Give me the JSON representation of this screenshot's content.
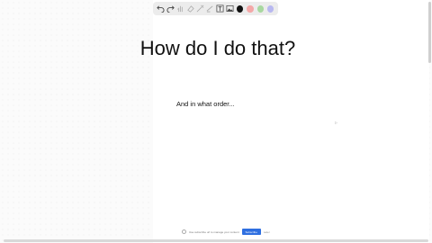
{
  "canvas": {
    "heading": "How do I do that?",
    "subtext": "And in what order..."
  },
  "toolbar": {
    "tools": [
      "undo-icon",
      "redo-icon",
      "hand-icon",
      "eraser-icon",
      "laser-icon",
      "highlighter-icon",
      "text-tool-icon",
      "image-tool-icon"
    ],
    "colors": [
      "#111111",
      "#f4a8a8",
      "#a8d8a0",
      "#b8b8f0"
    ]
  },
  "bottom_bar": {
    "message": "Use subscribe url to manage your content",
    "primary_label": "Subscribe",
    "secondary_label": "Later"
  }
}
